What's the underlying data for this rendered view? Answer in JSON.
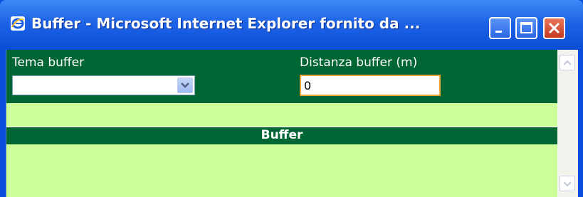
{
  "window": {
    "title": "Buffer - Microsoft Internet Explorer fornito da ..."
  },
  "form": {
    "tema_label": "Tema buffer",
    "tema_selected": "",
    "distanza_label": "Distanza buffer (m)",
    "distanza_value": "0"
  },
  "section": {
    "title": "Buffer"
  },
  "colors": {
    "panel_green": "#006633",
    "background_light_green": "#ccff99",
    "titlebar_blue": "#0b4ed6",
    "close_red": "#c5381e",
    "input_focus_border": "#e8a63c"
  },
  "icons": {
    "app": "ie-icon",
    "minimize": "minimize-icon",
    "maximize": "maximize-icon",
    "close": "close-icon",
    "dropdown": "chevron-down-icon",
    "scroll_up": "scroll-up-icon",
    "scroll_down": "scroll-down-icon"
  }
}
